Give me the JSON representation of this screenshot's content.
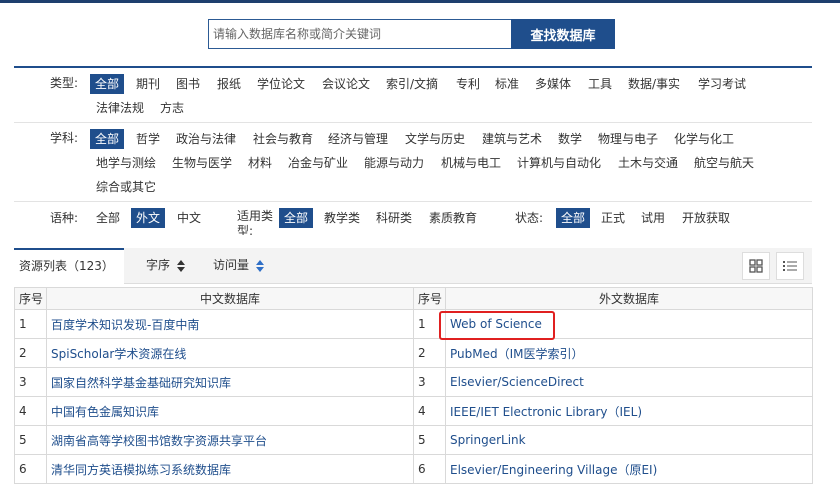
{
  "search": {
    "placeholder": "请输入数据库名称或简介关键词",
    "button_label": "查找数据库"
  },
  "filters": {
    "type": {
      "label": "类型:",
      "options": [
        "全部",
        "期刊",
        "图书",
        "报纸",
        "学位论文",
        "会议论文",
        "索引/文摘",
        "专利",
        "标准",
        "多媒体",
        "工具",
        "数据/事实",
        "学习考试",
        "法律法规",
        "方志"
      ],
      "active": "全部"
    },
    "subject": {
      "label": "学科:",
      "options": [
        "全部",
        "哲学",
        "政治与法律",
        "社会与教育",
        "经济与管理",
        "文学与历史",
        "建筑与艺术",
        "数学",
        "物理与电子",
        "化学与化工",
        "地学与测绘",
        "生物与医学",
        "材料",
        "冶金与矿业",
        "能源与动力",
        "机械与电工",
        "计算机与自动化",
        "土木与交通",
        "航空与航天",
        "综合或其它"
      ],
      "active": "全部"
    },
    "language": {
      "label": "语种:",
      "options": [
        "全部",
        "外文",
        "中文"
      ],
      "active": "外文"
    },
    "usage": {
      "label": "适用类型:",
      "options": [
        "全部",
        "教学类",
        "科研类",
        "素质教育"
      ],
      "active": "全部"
    },
    "status": {
      "label": "状态:",
      "options": [
        "全部",
        "正式",
        "试用",
        "开放获取"
      ],
      "active": "全部"
    }
  },
  "list": {
    "tab_label": "资源列表（123）",
    "sort_order": "字序",
    "sort_visits": "访问量",
    "view_grid_icon": "grid-view-icon",
    "view_list_icon": "list-view-icon"
  },
  "table": {
    "headers": [
      "序号",
      "中文数据库",
      "序号",
      "外文数据库"
    ],
    "rows": [
      {
        "cn_no": "1",
        "cn_name": "百度学术知识发现-百度中南",
        "en_no": "1",
        "en_name": "Web of Science"
      },
      {
        "cn_no": "2",
        "cn_name": "SpiScholar学术资源在线",
        "en_no": "2",
        "en_name": "PubMed（IM医学索引）"
      },
      {
        "cn_no": "3",
        "cn_name": "国家自然科学基金基础研究知识库",
        "en_no": "3",
        "en_name": "Elsevier/ScienceDirect"
      },
      {
        "cn_no": "4",
        "cn_name": "中国有色金属知识库",
        "en_no": "4",
        "en_name": "IEEE/IET Electronic Library（IEL)"
      },
      {
        "cn_no": "5",
        "cn_name": "湖南省高等学校图书馆数字资源共享平台",
        "en_no": "5",
        "en_name": "SpringerLink"
      },
      {
        "cn_no": "6",
        "cn_name": "清华同方英语模拟练习系统数据库",
        "en_no": "6",
        "en_name": "Elsevier/Engineering Village（原EI)"
      }
    ]
  },
  "colors": {
    "accent": "#1f4e8c",
    "highlight_box": "#e02020"
  }
}
